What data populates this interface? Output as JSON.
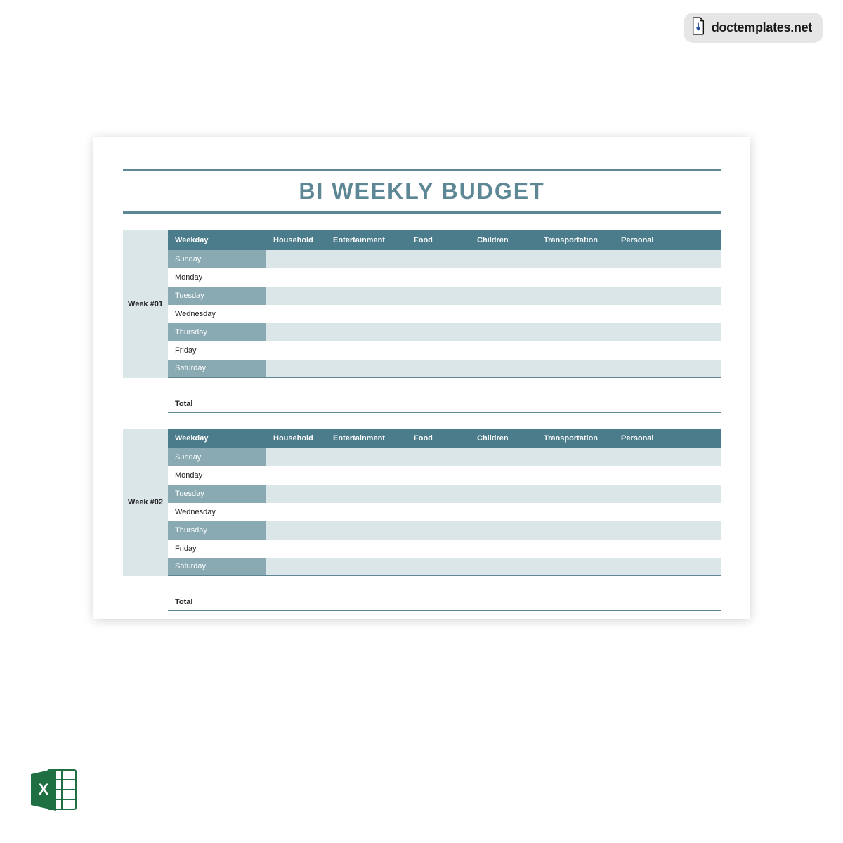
{
  "brand": {
    "text": "doctemplates.net"
  },
  "doc": {
    "title": "BI WEEKLY BUDGET",
    "columns": [
      "Weekday",
      "Household",
      "Entertainment",
      "Food",
      "Children",
      "Transportation",
      "Personal"
    ],
    "weeks": [
      {
        "label": "Week #01",
        "days": [
          "Sunday",
          "Monday",
          "Tuesday",
          "Wednesday",
          "Thursday",
          "Friday",
          "Saturday"
        ],
        "total_label": "Total"
      },
      {
        "label": "Week #02",
        "days": [
          "Sunday",
          "Monday",
          "Tuesday",
          "Wednesday",
          "Thursday",
          "Friday",
          "Saturday"
        ],
        "total_label": "Total"
      }
    ]
  },
  "footer": {
    "icon": "excel-icon"
  }
}
